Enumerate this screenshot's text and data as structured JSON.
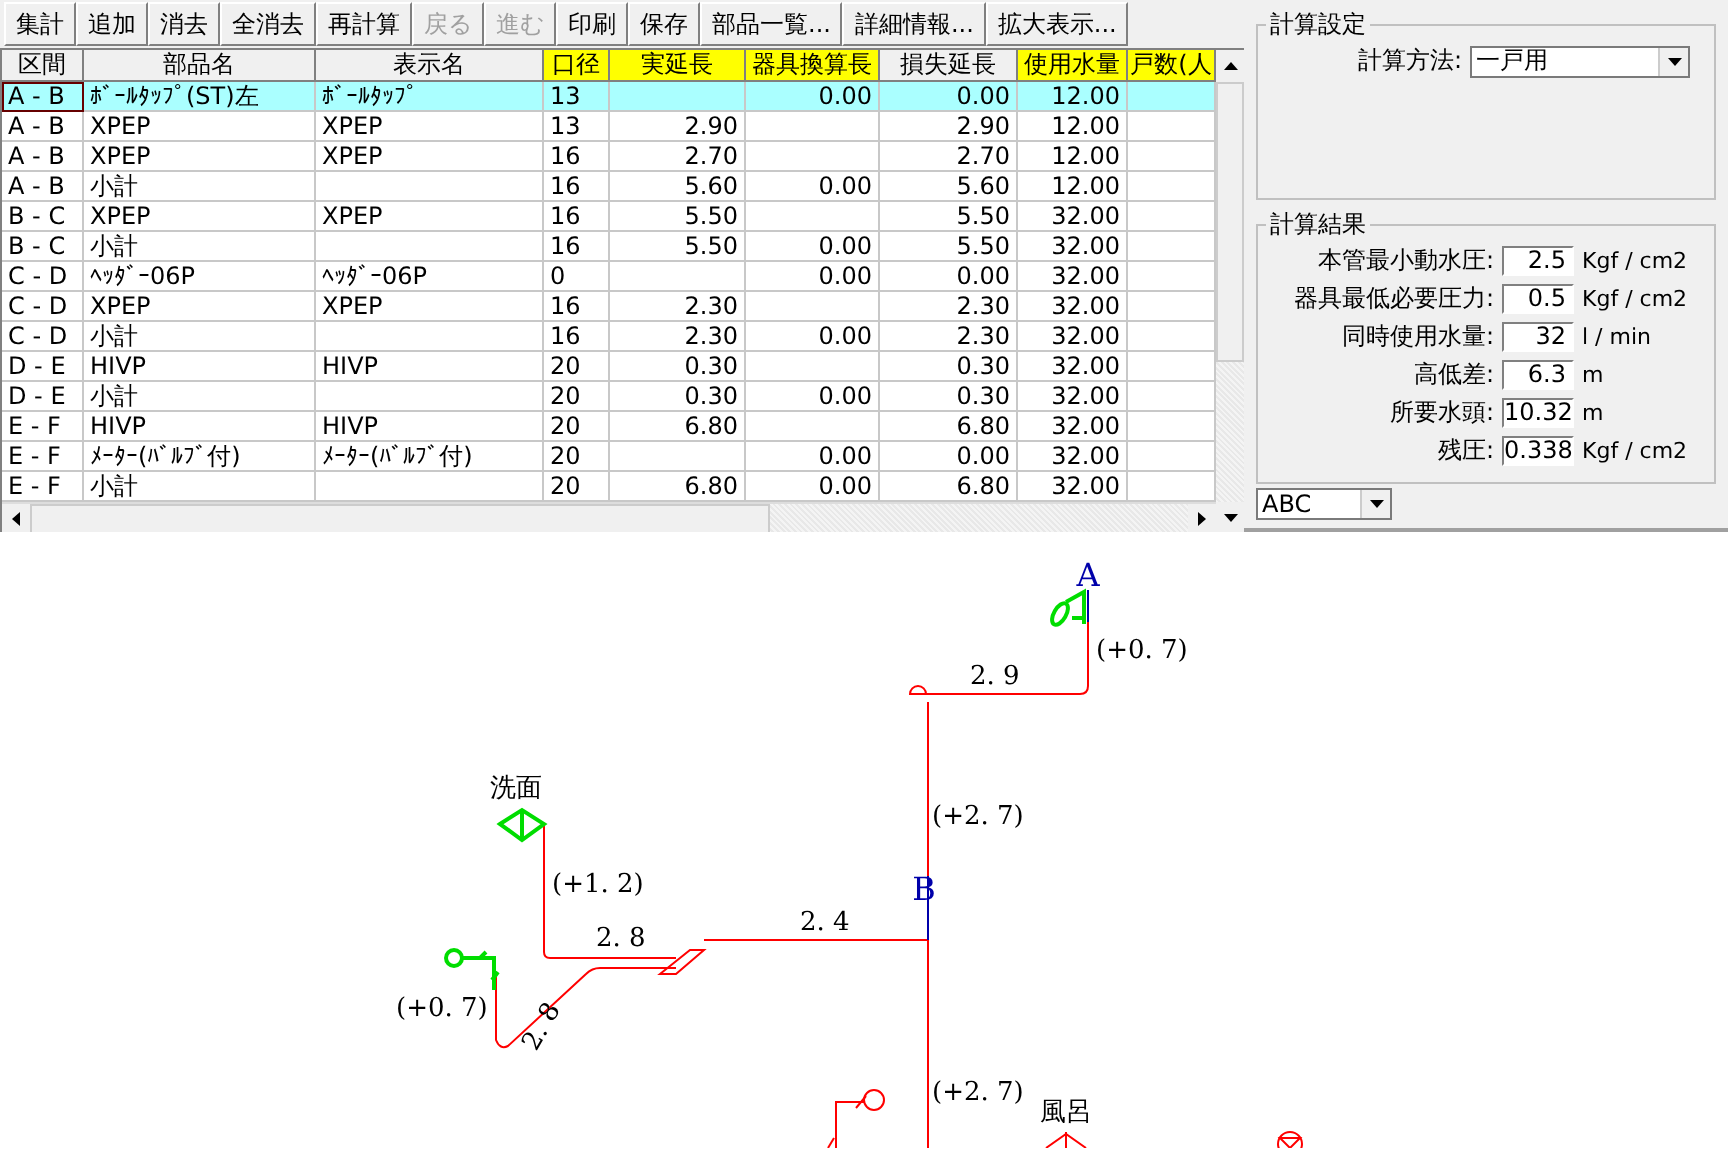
{
  "toolbar": [
    {
      "label": "集計",
      "disabled": false
    },
    {
      "label": "追加",
      "disabled": false
    },
    {
      "label": "消去",
      "disabled": false
    },
    {
      "label": "全消去",
      "disabled": false
    },
    {
      "label": "再計算",
      "disabled": false
    },
    {
      "label": "戻る",
      "disabled": true
    },
    {
      "label": "進む",
      "disabled": true
    },
    {
      "label": "印刷",
      "disabled": false
    },
    {
      "label": "保存",
      "disabled": false
    },
    {
      "label": "部品一覧...",
      "disabled": false
    },
    {
      "label": "詳細情報...",
      "disabled": false
    },
    {
      "label": "拡大表示...",
      "disabled": false
    }
  ],
  "table": {
    "columns": [
      {
        "label": "区間",
        "highlighted": false
      },
      {
        "label": "部品名",
        "highlighted": false
      },
      {
        "label": "表示名",
        "highlighted": false
      },
      {
        "label": "口径",
        "highlighted": true
      },
      {
        "label": "実延長",
        "highlighted": true
      },
      {
        "label": "器具換算長",
        "highlighted": true
      },
      {
        "label": "損失延長",
        "highlighted": false
      },
      {
        "label": "使用水量",
        "highlighted": true
      },
      {
        "label": "戸数(人",
        "highlighted": true
      }
    ],
    "rows": [
      {
        "selected": true,
        "cells": [
          "A - B",
          "ﾎﾞｰﾙﾀｯﾌﾟ(ST)左",
          "ﾎﾞｰﾙﾀｯﾌﾟ",
          "13",
          null,
          "0.00",
          "0.00",
          "12.00",
          null
        ]
      },
      {
        "selected": false,
        "cells": [
          "A - B",
          "XPEP",
          "XPEP",
          "13",
          "2.90",
          null,
          "2.90",
          "12.00",
          null
        ]
      },
      {
        "selected": false,
        "cells": [
          "A - B",
          "XPEP",
          "XPEP",
          "16",
          "2.70",
          null,
          "2.70",
          "12.00",
          null
        ]
      },
      {
        "selected": false,
        "cells": [
          "A - B",
          "小計",
          null,
          "16",
          "5.60",
          "0.00",
          "5.60",
          "12.00",
          null
        ]
      },
      {
        "selected": false,
        "cells": [
          "B - C",
          "XPEP",
          "XPEP",
          "16",
          "5.50",
          null,
          "5.50",
          "32.00",
          null
        ]
      },
      {
        "selected": false,
        "cells": [
          "B - C",
          "小計",
          null,
          "16",
          "5.50",
          "0.00",
          "5.50",
          "32.00",
          null
        ]
      },
      {
        "selected": false,
        "cells": [
          "C - D",
          "ﾍｯﾀﾞｰ06P",
          "ﾍｯﾀﾞｰ06P",
          "0",
          null,
          "0.00",
          "0.00",
          "32.00",
          null
        ]
      },
      {
        "selected": false,
        "cells": [
          "C - D",
          "XPEP",
          "XPEP",
          "16",
          "2.30",
          null,
          "2.30",
          "32.00",
          null
        ]
      },
      {
        "selected": false,
        "cells": [
          "C - D",
          "小計",
          null,
          "16",
          "2.30",
          "0.00",
          "2.30",
          "32.00",
          null
        ]
      },
      {
        "selected": false,
        "cells": [
          "D - E",
          "HIVP",
          "HIVP",
          "20",
          "0.30",
          null,
          "0.30",
          "32.00",
          null
        ]
      },
      {
        "selected": false,
        "cells": [
          "D - E",
          "小計",
          null,
          "20",
          "0.30",
          "0.00",
          "0.30",
          "32.00",
          null
        ]
      },
      {
        "selected": false,
        "cells": [
          "E - F",
          "HIVP",
          "HIVP",
          "20",
          "6.80",
          null,
          "6.80",
          "32.00",
          null
        ]
      },
      {
        "selected": false,
        "cells": [
          "E - F",
          "ﾒｰﾀｰ(ﾊﾞﾙﾌﾞ付)",
          "ﾒｰﾀｰ(ﾊﾞﾙﾌﾞ付)",
          "20",
          null,
          "0.00",
          "0.00",
          "32.00",
          null
        ]
      },
      {
        "selected": false,
        "cells": [
          "E - F",
          "小計",
          null,
          "20",
          "6.80",
          "0.00",
          "6.80",
          "32.00",
          null
        ]
      }
    ]
  },
  "settings": {
    "title": "計算設定",
    "method_label": "計算方法:",
    "method_value": "一戸用"
  },
  "results": {
    "title": "計算結果",
    "rows": [
      {
        "label": "本管最小動水圧:",
        "value": "2.5",
        "unit": "Kgf / cm2"
      },
      {
        "label": "器具最低必要圧力:",
        "value": "0.5",
        "unit": "Kgf / cm2"
      },
      {
        "label": "同時使用水量:",
        "value": "32",
        "unit": "l / min"
      },
      {
        "label": "高低差:",
        "value": "6.3",
        "unit": "m"
      },
      {
        "label": "所要水頭:",
        "value": "10.32",
        "unit": "m"
      },
      {
        "label": "残圧:",
        "value": "0.338",
        "unit": "Kgf / cm2"
      }
    ]
  },
  "view_select": {
    "value": "ABC"
  },
  "diagram": {
    "labels": [
      {
        "kind": "node",
        "text": "A"
      },
      {
        "kind": "length",
        "text": "2. 9"
      },
      {
        "kind": "height",
        "text": "(+0. 7)"
      },
      {
        "kind": "height",
        "text": "(+2. 7)"
      },
      {
        "kind": "node",
        "text": "B"
      },
      {
        "kind": "fixture",
        "text": "洗面"
      },
      {
        "kind": "height",
        "text": "(+1. 2)"
      },
      {
        "kind": "length",
        "text": "2. 8"
      },
      {
        "kind": "length",
        "text": "2. 4"
      },
      {
        "kind": "height",
        "text": "(+0. 7)"
      },
      {
        "kind": "slanted",
        "text": "2. 8"
      },
      {
        "kind": "height",
        "text": "(+2. 7)"
      },
      {
        "kind": "fixture",
        "text": "風呂"
      }
    ]
  }
}
